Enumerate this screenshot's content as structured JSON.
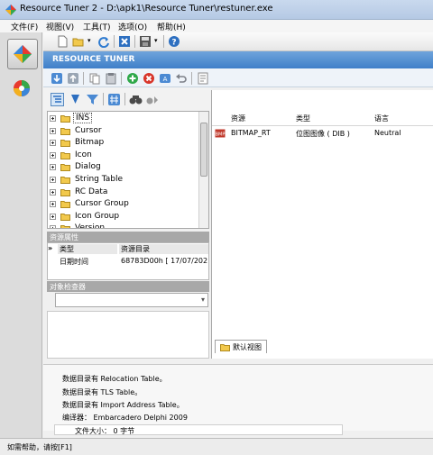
{
  "window": {
    "title": "Resource Tuner 2 - D:\\apk1\\Resource Tuner\\restuner.exe"
  },
  "menu": [
    "文件(F)",
    "视图(V)",
    "工具(T)",
    "选项(O)",
    "帮助(H)"
  ],
  "header": {
    "title": "RESOURCE TUNER"
  },
  "tree": {
    "items": [
      {
        "label": "INS",
        "selected": true
      },
      {
        "label": "Cursor"
      },
      {
        "label": "Bitmap"
      },
      {
        "label": "Icon"
      },
      {
        "label": "Dialog"
      },
      {
        "label": "String Table"
      },
      {
        "label": "RC Data"
      },
      {
        "label": "Cursor Group"
      },
      {
        "label": "Icon Group"
      },
      {
        "label": "Version"
      }
    ]
  },
  "properties": {
    "section_title": "资源属性",
    "col_type": "类型",
    "col_dir": "资源目录",
    "rows": [
      {
        "key": "日期时间",
        "value": "68783D00h [ 17/07/202..."
      }
    ]
  },
  "inspector": {
    "section_title": "对象检查器"
  },
  "list": {
    "columns": [
      "资源",
      "类型",
      "语言"
    ],
    "rows": [
      {
        "resource": "BITMAP_RT",
        "type": "位图图像 ( DIB )",
        "language": "Neutral"
      }
    ]
  },
  "tab": {
    "label": "默认视图"
  },
  "log": [
    "数据目录有 Relocation Table。",
    "数据目录有 TLS Table。",
    "数据目录有 Import Address Table。",
    "编译器： Embarcadero Delphi 2009",
    "文件大小： 0 字节"
  ],
  "status": {
    "text": "如需帮助，请按[F1]"
  },
  "colors": {
    "header_blue": "#4a86cf",
    "menu_bg": "#f5f5f5"
  }
}
